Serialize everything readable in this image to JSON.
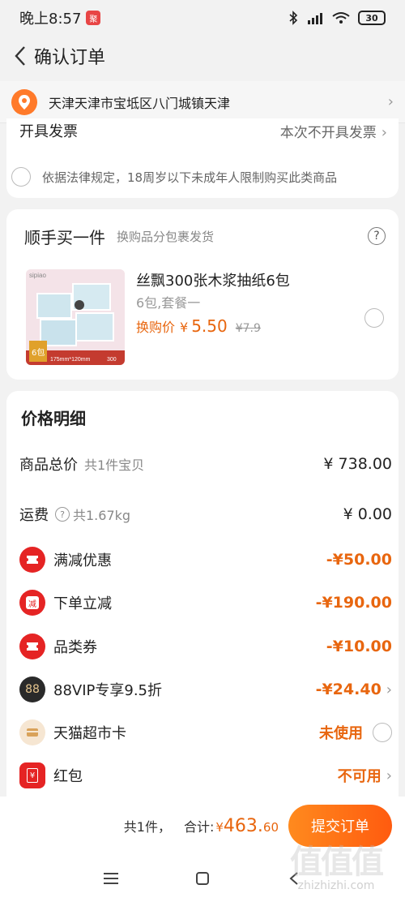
{
  "status_bar": {
    "time": "晚上8:57",
    "notification_badge": "聚",
    "battery": "30"
  },
  "nav": {
    "title": "确认订单"
  },
  "address": {
    "text": "天津天津市宝坻区八门城镇天津"
  },
  "invoice": {
    "label": "开具发票",
    "value": "本次不开具发票"
  },
  "age_notice": {
    "text": "依据法律规定，18周岁以下未成年人限制购买此类商品"
  },
  "addon": {
    "title": "顺手买一件",
    "subtitle": "换购品分包裹发货",
    "product": {
      "name": "丝飘300张木浆抽纸6包",
      "spec": "6包,套餐一",
      "price_label": "换购价",
      "currency": "¥",
      "price": "5.50",
      "original_price": "¥7.9",
      "image_brand": "sipiao",
      "image_count": "6包",
      "image_size": "175mm*120mm",
      "image_sheets": "300"
    }
  },
  "details": {
    "title": "价格明细",
    "rows": [
      {
        "label": "商品总价",
        "sub": "共1件宝贝",
        "amount": "¥ 738.00"
      },
      {
        "label": "运费",
        "sub": "共1.67kg",
        "amount": "¥ 0.00"
      },
      {
        "label": "满减优惠",
        "amount": "-¥50.00"
      },
      {
        "label": "下单立减",
        "amount": "-¥190.00",
        "icon_text": "减"
      },
      {
        "label": "品类券",
        "amount": "-¥10.00"
      },
      {
        "label": "88VIP专享9.5折",
        "amount": "-¥24.40",
        "icon_text": "88"
      },
      {
        "label": "天猫超市卡",
        "amount": "未使用"
      },
      {
        "label": "红包",
        "amount": "不可用",
        "icon_text": "¥"
      }
    ]
  },
  "footer": {
    "count": "共1件，",
    "total_label": "合计:",
    "currency": "¥",
    "total_int": "463.",
    "total_dec": "60",
    "submit": "提交订单"
  },
  "watermark": {
    "big": "值值值",
    "small": "zhizhizhi.com"
  },
  "colors": {
    "accent": "#e8660f",
    "coupon_red": "#e52424",
    "location_orange": "#ff7a2a"
  }
}
